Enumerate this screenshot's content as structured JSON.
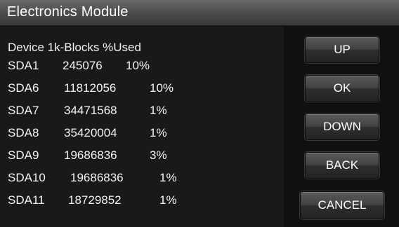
{
  "header": {
    "title": "Electronics Module"
  },
  "table": {
    "header": "Device 1k-Blocks %Used",
    "rows": [
      {
        "device": "SDA1",
        "blocks": "245076",
        "used": "10%"
      },
      {
        "device": "SDA6",
        "blocks": "11812056",
        "used": "10%"
      },
      {
        "device": "SDA7",
        "blocks": "34471568",
        "used": "1%"
      },
      {
        "device": "SDA8",
        "blocks": "35420004",
        "used": "1%"
      },
      {
        "device": "SDA9",
        "blocks": "19686836",
        "used": "3%"
      },
      {
        "device": "SDA10",
        "blocks": "19686836",
        "used": "1%"
      },
      {
        "device": "SDA11",
        "blocks": "18729852",
        "used": "1%"
      }
    ]
  },
  "buttons": {
    "up": "UP",
    "ok": "OK",
    "down": "DOWN",
    "back": "BACK",
    "cancel": "CANCEL"
  }
}
